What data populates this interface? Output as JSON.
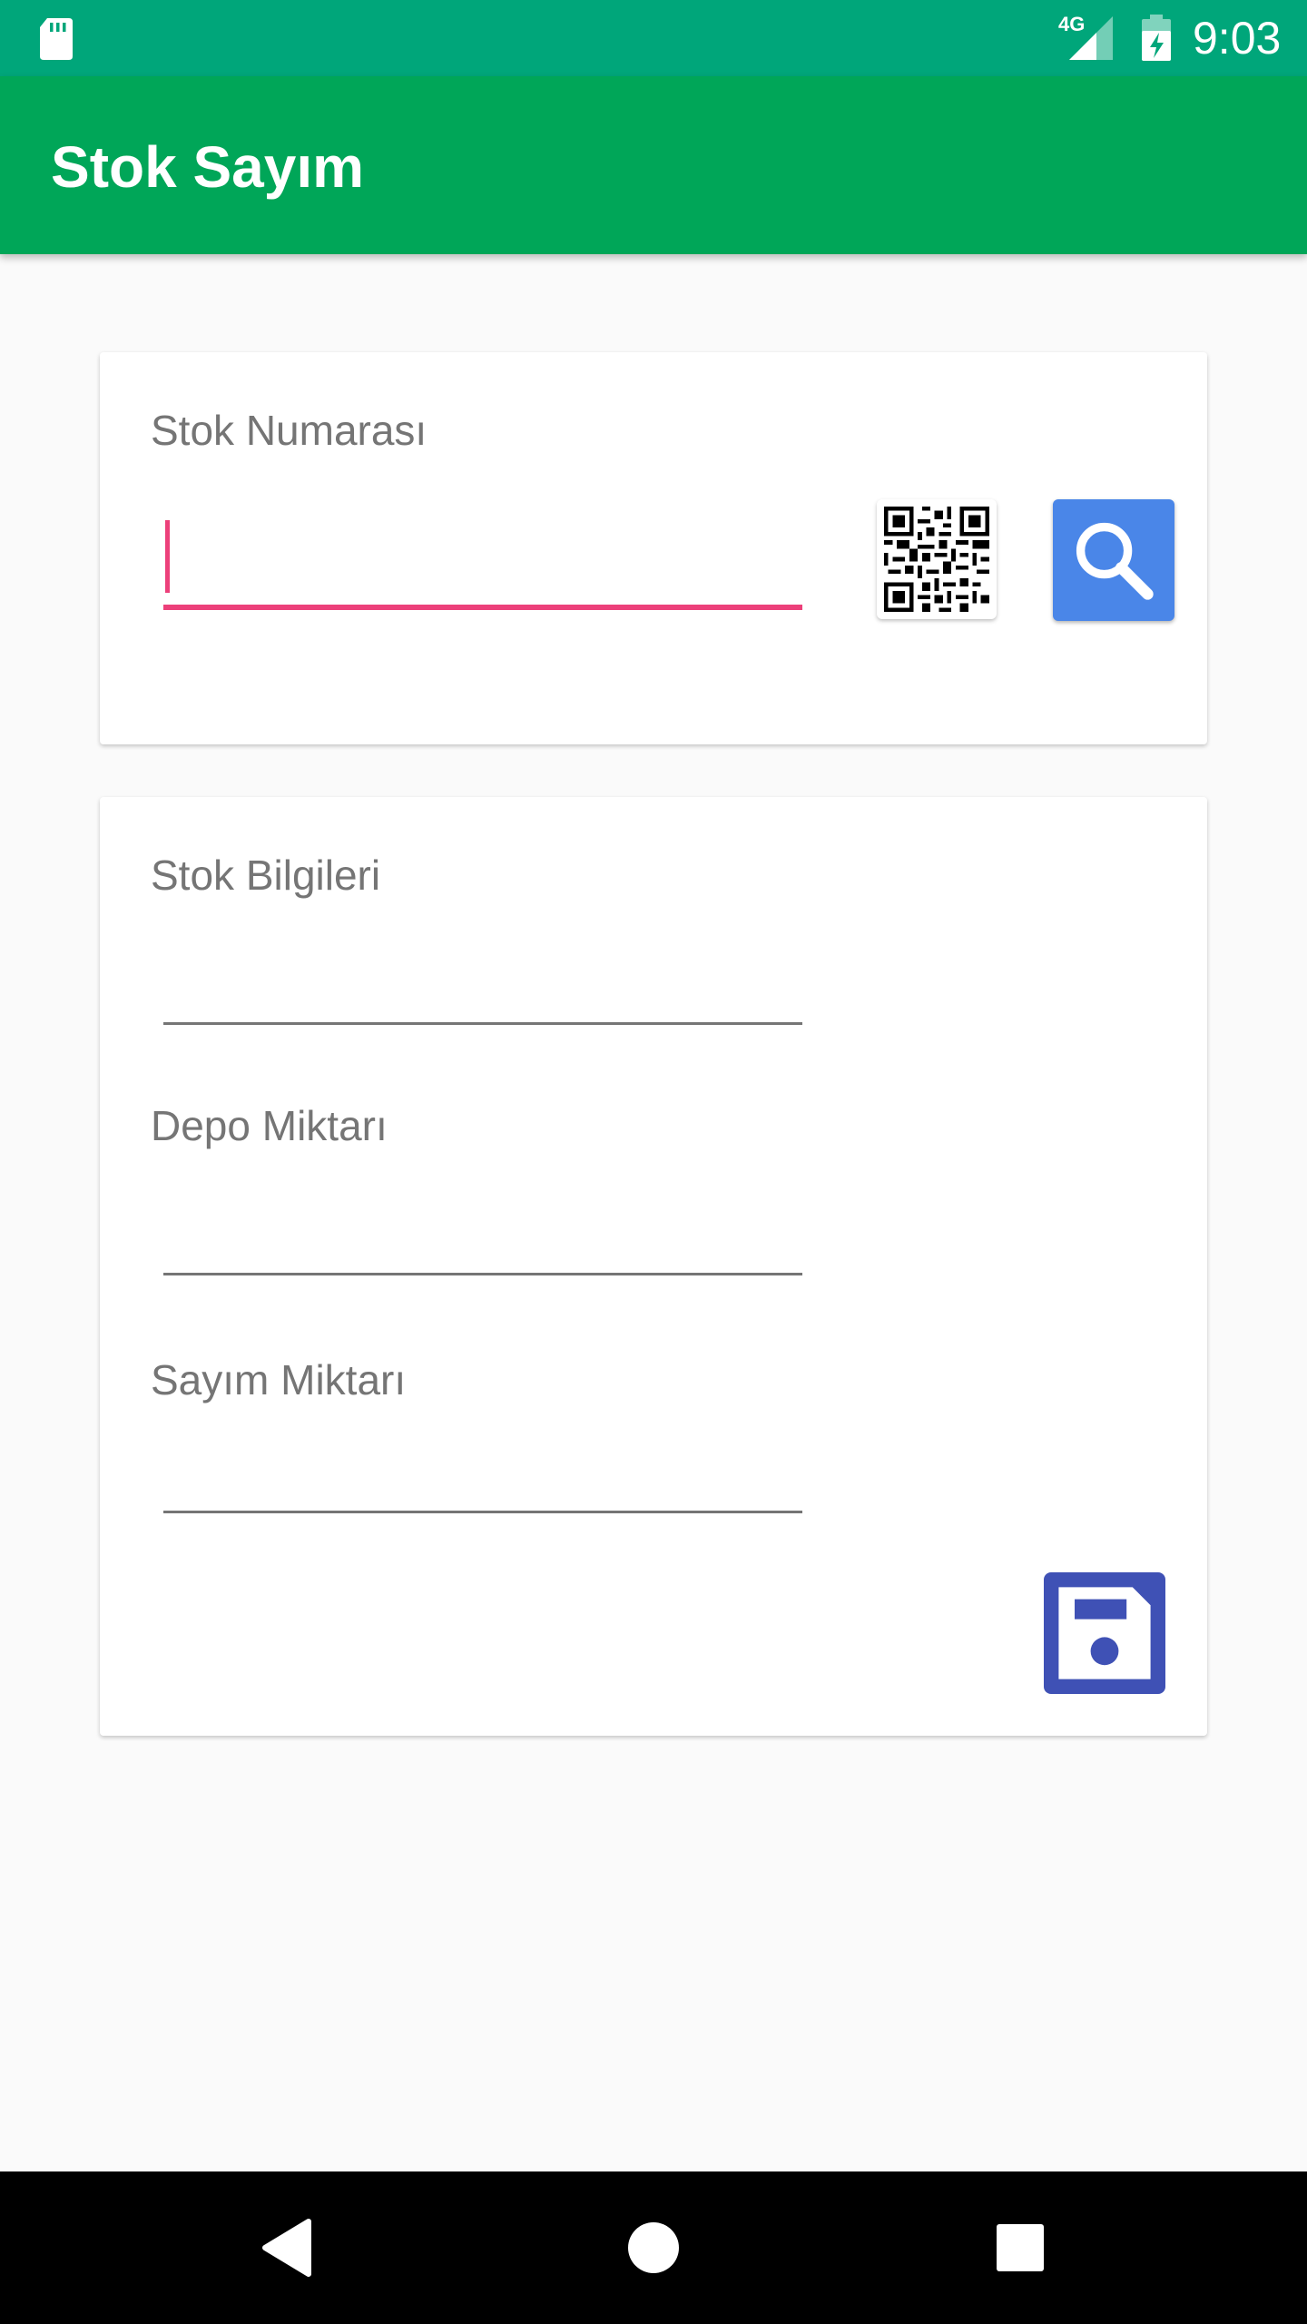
{
  "status_bar": {
    "time": "9:03",
    "network": "4G",
    "icons": [
      "sd-card-icon",
      "signal-icon",
      "battery-charging-icon"
    ]
  },
  "app_bar": {
    "title": "Stok Sayım"
  },
  "search_card": {
    "stock_number": {
      "label": "Stok Numarası",
      "value": ""
    },
    "qr_button_icon": "qr-code-icon",
    "search_button_icon": "magnifier-icon"
  },
  "info_card": {
    "stock_info": {
      "label": "Stok Bilgileri",
      "value": ""
    },
    "warehouse_qty": {
      "label": "Depo Miktarı",
      "value": ""
    },
    "count_qty": {
      "label": "Sayım Miktarı",
      "value": ""
    },
    "save_button_icon": "floppy-disk-icon"
  },
  "nav_bar": {
    "icons": [
      "back-icon",
      "home-icon",
      "recents-icon"
    ]
  },
  "colors": {
    "status_bar": "#00a67a",
    "app_bar": "#00a658",
    "accent": "#ec407a",
    "search_button": "#4a86e8",
    "save_button": "#3f51b5",
    "background": "#fafafa"
  }
}
